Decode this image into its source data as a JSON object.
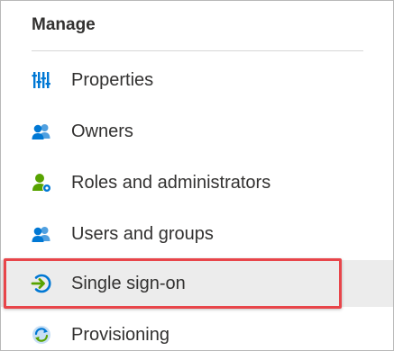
{
  "section": {
    "title": "Manage"
  },
  "nav": {
    "items": [
      {
        "label": "Properties",
        "icon": "properties-icon"
      },
      {
        "label": "Owners",
        "icon": "owners-icon"
      },
      {
        "label": "Roles and administrators",
        "icon": "roles-icon"
      },
      {
        "label": "Users and groups",
        "icon": "users-groups-icon"
      },
      {
        "label": "Single sign-on",
        "icon": "single-sign-on-icon",
        "selected": true
      },
      {
        "label": "Provisioning",
        "icon": "provisioning-icon"
      }
    ]
  },
  "colors": {
    "accent_blue": "#0078d4",
    "green": "#57a300",
    "highlight_red": "#e8454a",
    "selected_bg": "#ececec"
  }
}
